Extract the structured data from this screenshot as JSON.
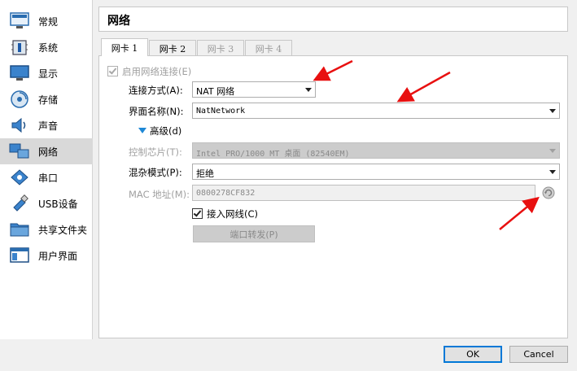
{
  "sidebar": {
    "items": [
      {
        "label": "常规",
        "icon": "general-icon"
      },
      {
        "label": "系统",
        "icon": "system-icon"
      },
      {
        "label": "显示",
        "icon": "display-icon"
      },
      {
        "label": "存储",
        "icon": "storage-icon"
      },
      {
        "label": "声音",
        "icon": "audio-icon"
      },
      {
        "label": "网络",
        "icon": "network-icon",
        "active": true
      },
      {
        "label": "串口",
        "icon": "serial-port-icon"
      },
      {
        "label": "USB设备",
        "icon": "usb-icon"
      },
      {
        "label": "共享文件夹",
        "icon": "shared-folder-icon"
      },
      {
        "label": "用户界面",
        "icon": "user-interface-icon"
      }
    ]
  },
  "header": {
    "title": "网络"
  },
  "tabs": [
    {
      "label": "网卡 1",
      "state": "active"
    },
    {
      "label": "网卡 2",
      "state": "enabled"
    },
    {
      "label": "网卡 3",
      "state": "disabled"
    },
    {
      "label": "网卡 4",
      "state": "disabled"
    }
  ],
  "adapter": {
    "enable_label": "启用网络连接(E)",
    "enabled": true,
    "attach_label": "连接方式(A):",
    "attach_value": "NAT 网络",
    "name_label": "界面名称(N):",
    "name_value": "NatNetwork",
    "advanced_label": "高级(d)",
    "chip_label": "控制芯片(T):",
    "chip_value": "Intel PRO/1000 MT 桌面 (82540EM)",
    "promisc_label": "混杂模式(P):",
    "promisc_value": "拒绝",
    "mac_label": "MAC 地址(M):",
    "mac_value": "0800278CF832",
    "cable_label": "接入网线(C)",
    "cable_connected": true,
    "port_forward_label": "端口转发(P)"
  },
  "buttons": {
    "ok": "OK",
    "cancel": "Cancel"
  },
  "colors": {
    "accent": "#0078d7",
    "annotation_arrow": "#e81010"
  }
}
